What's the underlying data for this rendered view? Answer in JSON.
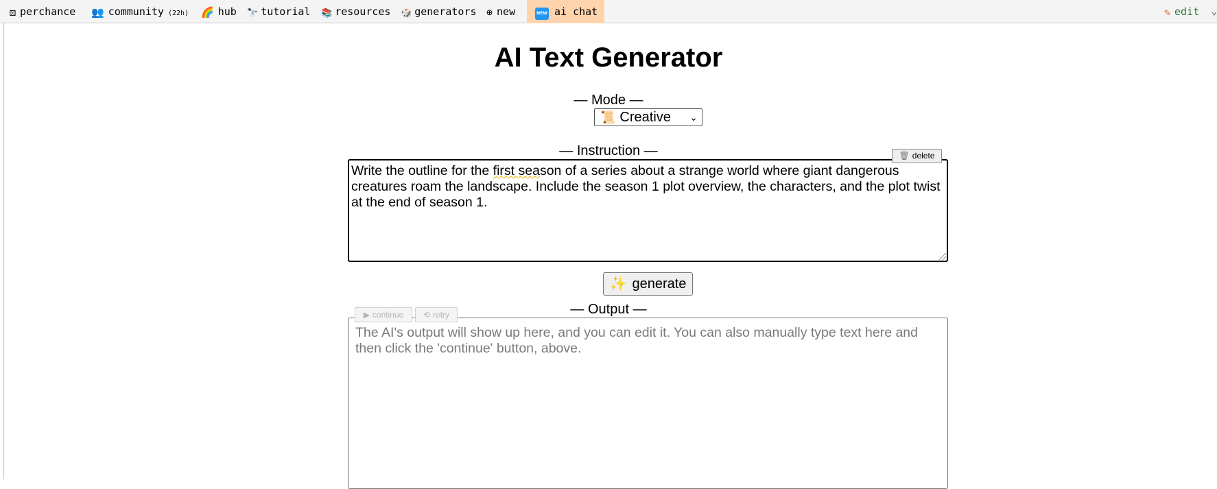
{
  "nav": {
    "perchance": {
      "icon": "dice-icon",
      "label": "perchance"
    },
    "community": {
      "icon": "people-icon",
      "label": "community",
      "sub": "(22h)"
    },
    "hub": {
      "icon": "rainbow-icon",
      "label": "hub"
    },
    "tutorial": {
      "icon": "binoculars-icon",
      "label": "tutorial"
    },
    "resources": {
      "icon": "bookshelf-icon",
      "label": "resources"
    },
    "generators": {
      "icon": "dice-pair-icon",
      "label": "generators"
    },
    "new": {
      "icon": "globe-plus-icon",
      "label": "new"
    },
    "ai_chat": {
      "icon": "new-badge-icon",
      "badge": "NEW",
      "label": "ai chat"
    },
    "edit": {
      "icon": "pencil-icon",
      "label": "edit"
    }
  },
  "colors": {
    "ai_chat_bg": "#ffd4ad",
    "new_badge": "#2196f3",
    "edit_link": "#2a7a2a"
  },
  "page": {
    "title": "AI Text Generator"
  },
  "mode": {
    "label": "— Mode —",
    "selected": "Creative",
    "icon": "scroll-icon"
  },
  "instruction": {
    "label": "— Instruction —",
    "delete_label": "delete",
    "text_before": "Write the outline for the ",
    "misspelled": "first sea",
    "text_after": "son of a series about a strange world where giant dangerous creatures roam the landscape. Include the season 1 plot overview, the characters, and the plot twist at the end of season 1."
  },
  "generate": {
    "label": "generate",
    "icon": "sparkles-icon"
  },
  "output": {
    "label": "— Output —",
    "continue_label": "continue",
    "retry_label": "retry",
    "placeholder": "The AI's output will show up here, and you can edit it. You can also manually type text here and then click the 'continue' button, above."
  }
}
